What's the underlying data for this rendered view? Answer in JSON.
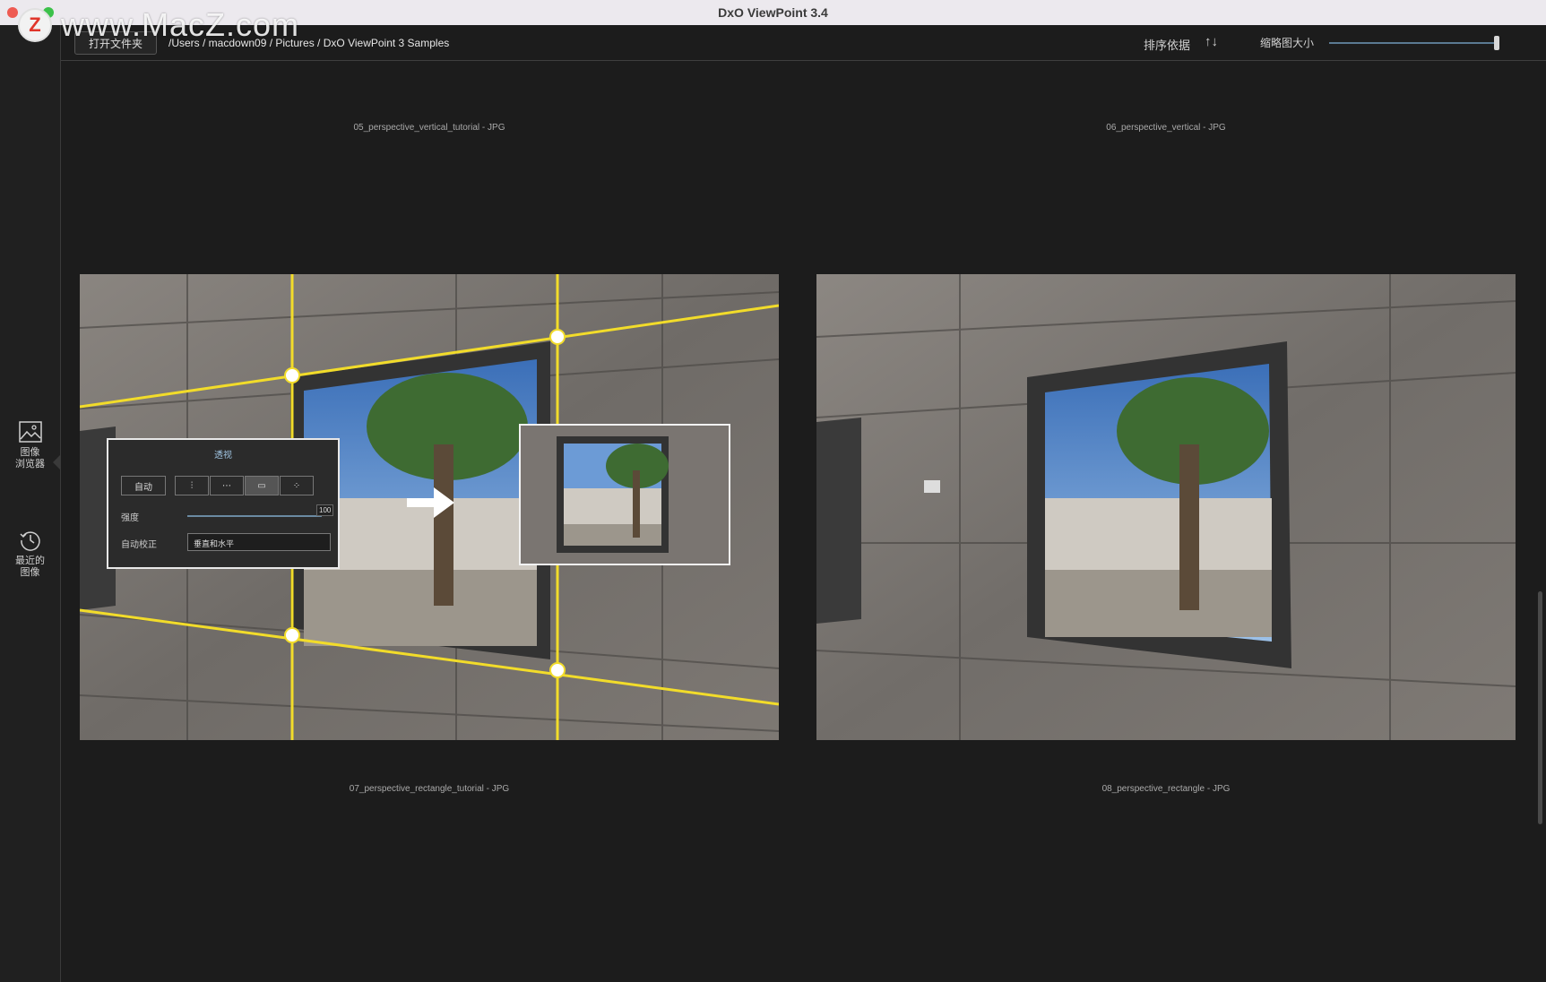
{
  "window": {
    "title": "DxO ViewPoint 3.4"
  },
  "watermark": {
    "logo_letter": "Z",
    "text": "www.MacZ.com"
  },
  "sidebar": {
    "items": [
      {
        "label_line1": "图像",
        "label_line2": "浏览器",
        "icon": "image-browser-icon"
      },
      {
        "label_line1": "最近的",
        "label_line2": "图像",
        "icon": "history-icon"
      }
    ]
  },
  "toolbar": {
    "open_folder_label": "打开文件夹",
    "path": "/Users / macdown09 / Pictures / DxO ViewPoint 3 Samples",
    "sort_label": "排序依据",
    "sort_icon": "↑↓",
    "thumb_size_label": "缩略图大小",
    "thumb_size_value": 1.0
  },
  "grid": {
    "items": [
      {
        "caption": "05_perspective_vertical_tutorial - JPG"
      },
      {
        "caption": "06_perspective_vertical - JPG"
      },
      {
        "caption": "07_perspective_rectangle_tutorial - JPG"
      },
      {
        "caption": "08_perspective_rectangle - JPG"
      }
    ]
  },
  "overlay_panel": {
    "title": "透视",
    "auto_button": "自动",
    "strength_label": "强度",
    "strength_value": "100",
    "auto_correct_label": "自动校正",
    "auto_correct_value": "垂直和水平"
  },
  "colors": {
    "guide_yellow": "#f2dc2a",
    "background": "#1c1c1c",
    "accent_blue": "#5a7a92"
  }
}
